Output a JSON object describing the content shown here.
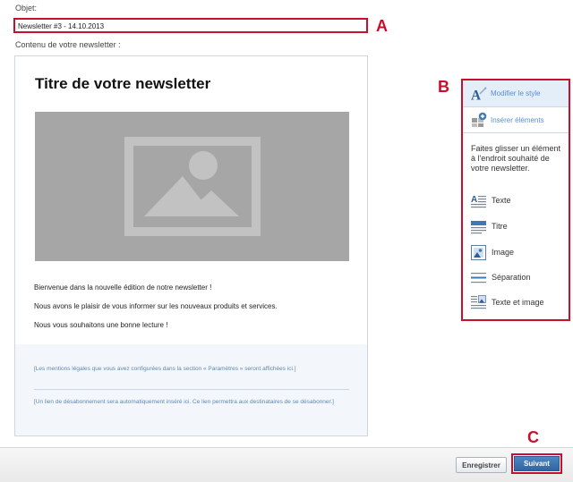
{
  "form": {
    "objet_label": "Objet:",
    "subject_value": "Newsletter #3 - 14.10.2013",
    "content_label": "Contenu de votre newsletter :"
  },
  "markers": {
    "a": "A",
    "b": "B",
    "c": "C"
  },
  "newsletter": {
    "title": "Titre de votre newsletter",
    "paragraphs": [
      "Bienvenue dans la nouvelle édition de notre newsletter !",
      "Nous avons le plaisir de vous informer sur les nouveaux produits et services.",
      "Nous vous souhaitons une bonne lecture !"
    ],
    "footer": {
      "legal": "[Les mentions légales que vous avez configurées dans la section « Paramètres » seront affichées ici.]",
      "unsubscribe": "[Un lien de désabonnement sera automatiquement inséré ici. Ce lien permettra aux destinataires de se désabonner.]"
    }
  },
  "panel": {
    "modify_style": "Modifier le style",
    "insert_elements": "Insérer éléments",
    "help_text": "Faites glisser un élément à l'endroit souhaité de votre newsletter.",
    "items": [
      {
        "label": "Texte",
        "icon": "text-block-icon"
      },
      {
        "label": "Titre",
        "icon": "title-block-icon"
      },
      {
        "label": "Image",
        "icon": "image-block-icon"
      },
      {
        "label": "Séparation",
        "icon": "separator-block-icon"
      },
      {
        "label": "Texte et image",
        "icon": "text-image-block-icon"
      }
    ]
  },
  "footer_bar": {
    "save_label": "Enregistrer",
    "next_label": "Suivant"
  },
  "colors": {
    "highlight_red": "#c8102e",
    "link_blue": "#5a8fd0",
    "primary_button": "#3a72b2",
    "image_placeholder": "#a6a6a6"
  }
}
